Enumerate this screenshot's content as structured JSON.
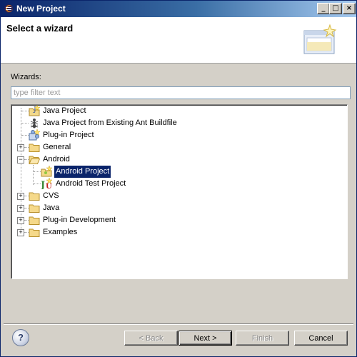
{
  "window": {
    "title": "New Project",
    "controls": {
      "minimize": "_",
      "maximize": "□",
      "close": "×"
    }
  },
  "banner": {
    "title": "Select a wizard",
    "image": "new-project-wizard-icon"
  },
  "wizards": {
    "label": "Wizards:",
    "filter_placeholder": "type filter text",
    "filter_value": ""
  },
  "tree": {
    "items": [
      {
        "label": "Java Project",
        "icon": "java-project-icon",
        "level": 0,
        "expander": "none"
      },
      {
        "label": "Java Project from Existing Ant Buildfile",
        "icon": "ant-icon",
        "level": 0,
        "expander": "none"
      },
      {
        "label": "Plug-in Project",
        "icon": "plugin-project-icon",
        "level": 0,
        "expander": "none"
      },
      {
        "label": "General",
        "icon": "folder-icon",
        "level": 0,
        "expander": "collapsed"
      },
      {
        "label": "Android",
        "icon": "folder-open-icon",
        "level": 0,
        "expander": "expanded"
      },
      {
        "label": "Android Project",
        "icon": "android-project-icon",
        "level": 1,
        "expander": "none",
        "selected": true
      },
      {
        "label": "Android Test Project",
        "icon": "junit-icon",
        "level": 1,
        "expander": "none"
      },
      {
        "label": "CVS",
        "icon": "folder-icon",
        "level": 0,
        "expander": "collapsed"
      },
      {
        "label": "Java",
        "icon": "folder-icon",
        "level": 0,
        "expander": "collapsed"
      },
      {
        "label": "Plug-in Development",
        "icon": "folder-icon",
        "level": 0,
        "expander": "collapsed"
      },
      {
        "label": "Examples",
        "icon": "folder-icon",
        "level": 0,
        "expander": "collapsed"
      }
    ]
  },
  "buttons": {
    "help": "?",
    "back": "< Back",
    "next": "Next >",
    "finish": "Finish",
    "cancel": "Cancel"
  },
  "colors": {
    "selection": "#0a246a",
    "titlebar_start": "#0a246a",
    "dialog_bg": "#d4d0c8"
  }
}
